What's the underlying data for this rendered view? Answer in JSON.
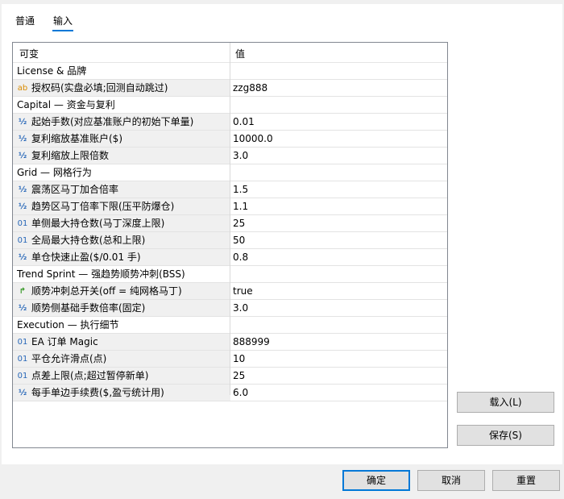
{
  "tabs": [
    {
      "label": "普通"
    },
    {
      "label": "输入"
    }
  ],
  "grid": {
    "header": {
      "variable": "可变",
      "value": "值"
    },
    "rows": [
      {
        "kind": "cat",
        "name": "License & 品牌",
        "value": ""
      },
      {
        "kind": "item",
        "icon": "ab",
        "name": "授权码(实盘必填;回测自动跳过)",
        "value": "zzg888"
      },
      {
        "kind": "cat",
        "name": "Capital — 资金与复利",
        "value": ""
      },
      {
        "kind": "item",
        "icon": "½",
        "name": "起始手数(对应基准账户的初始下单量)",
        "value": "0.01"
      },
      {
        "kind": "item",
        "icon": "½",
        "name": "复利缩放基准账户($)",
        "value": "10000.0"
      },
      {
        "kind": "item",
        "icon": "½",
        "name": "复利缩放上限倍数",
        "value": "3.0"
      },
      {
        "kind": "cat",
        "name": "Grid — 网格行为",
        "value": ""
      },
      {
        "kind": "item",
        "icon": "½",
        "name": "震荡区马丁加合倍率",
        "value": "1.5"
      },
      {
        "kind": "item",
        "icon": "½",
        "name": "趋势区马丁倍率下限(压平防爆仓)",
        "value": "1.1"
      },
      {
        "kind": "item",
        "icon": "01",
        "name": "单侧最大持仓数(马丁深度上限)",
        "value": "25"
      },
      {
        "kind": "item",
        "icon": "01",
        "name": "全局最大持仓数(总和上限)",
        "value": "50"
      },
      {
        "kind": "item",
        "icon": "½",
        "name": "单仓快速止盈($/0.01 手)",
        "value": "0.8"
      },
      {
        "kind": "cat",
        "name": "Trend Sprint — 强趋势顺势冲刺(BSS)",
        "value": ""
      },
      {
        "kind": "item",
        "icon": "↱",
        "name": "顺势冲刺总开关(off = 纯网格马丁)",
        "value": "true"
      },
      {
        "kind": "item",
        "icon": "½",
        "name": "顺势侧基础手数倍率(固定)",
        "value": "3.0"
      },
      {
        "kind": "cat",
        "name": "Execution — 执行细节",
        "value": ""
      },
      {
        "kind": "item",
        "icon": "01",
        "name": "EA 订单 Magic",
        "value": "888999"
      },
      {
        "kind": "item",
        "icon": "01",
        "name": "平仓允许滑点(点)",
        "value": "10"
      },
      {
        "kind": "item",
        "icon": "01",
        "name": "点差上限(点;超过暂停新单)",
        "value": "25"
      },
      {
        "kind": "item",
        "icon": "½",
        "name": "每手单边手续费($,盈亏统计用)",
        "value": "6.0"
      }
    ]
  },
  "buttons": {
    "load": "载入(L)",
    "save": "保存(S)",
    "ok": "确定",
    "cancel": "取消",
    "reset": "重置"
  }
}
